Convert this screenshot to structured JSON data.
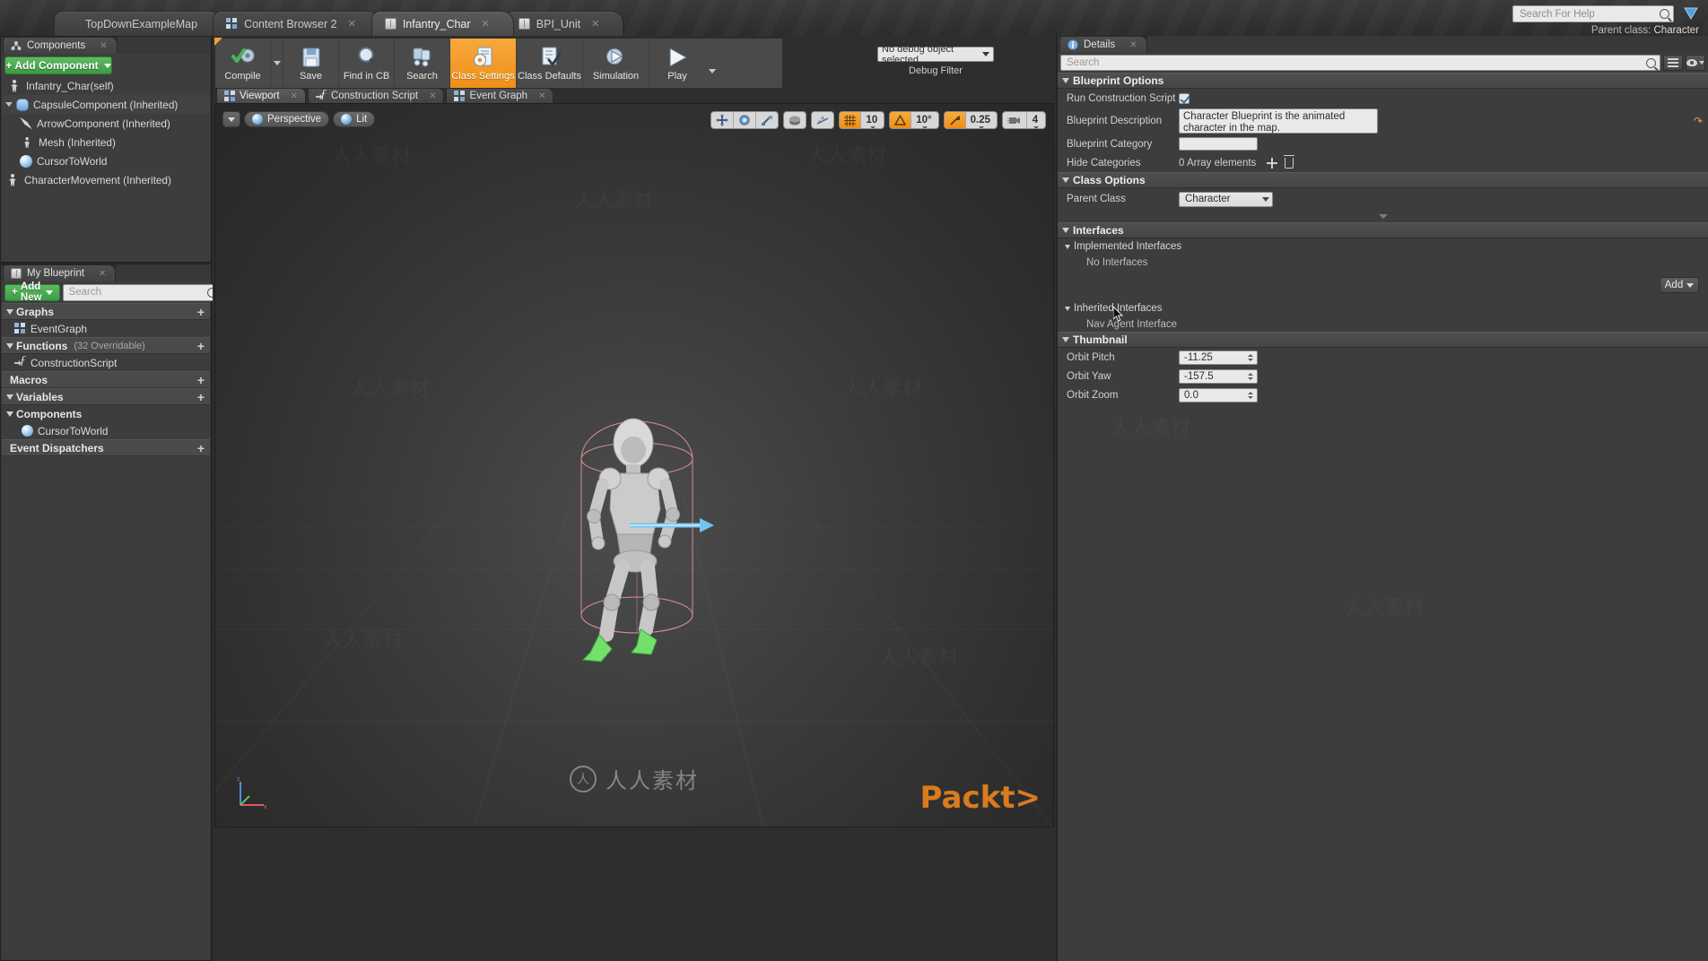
{
  "window": {
    "tabs": [
      {
        "label": "TopDownExampleMap",
        "icon": "map-icon",
        "closable": false,
        "active": false
      },
      {
        "label": "Content Browser 2",
        "icon": "grid-icon",
        "closable": true,
        "active": false
      },
      {
        "label": "Infantry_Char",
        "icon": "blueprint-icon",
        "closable": true,
        "active": true
      },
      {
        "label": "BPI_Unit",
        "icon": "blueprint-icon",
        "closable": true,
        "active": false
      }
    ],
    "help_search_placeholder": "Search For Help",
    "parent_class_label": "Parent class:",
    "parent_class_value": "Character"
  },
  "components_panel": {
    "tab_label": "Components",
    "tab_icon": "components-icon",
    "add_component_label": "Add Component",
    "tree": [
      {
        "label": "Infantry_Char(self)",
        "icon": "character-icon",
        "indent": 0,
        "expander": "none"
      },
      {
        "label": "CapsuleComponent (Inherited)",
        "icon": "capsule-icon",
        "indent": 0,
        "expander": "expanded"
      },
      {
        "label": "ArrowComponent (Inherited)",
        "icon": "arrow-icon",
        "indent": 1,
        "expander": "none"
      },
      {
        "label": "Mesh (Inherited)",
        "icon": "skeletal-mesh-icon",
        "indent": 1,
        "expander": "none"
      },
      {
        "label": "CursorToWorld",
        "icon": "decal-icon",
        "indent": 1,
        "expander": "none"
      },
      {
        "label": "CharacterMovement (Inherited)",
        "icon": "movement-icon",
        "indent": 0,
        "expander": "none"
      }
    ]
  },
  "my_blueprint_panel": {
    "tab_label": "My Blueprint",
    "tab_icon": "blueprint-icon",
    "add_new_label": "Add New",
    "search_placeholder": "Search",
    "sections": [
      {
        "title": "Graphs",
        "sub": "",
        "plus": "+",
        "items": [
          {
            "label": "EventGraph",
            "icon": "event-graph-icon"
          }
        ]
      },
      {
        "title": "Functions",
        "sub": "(32 Overridable)",
        "plus": "+",
        "items": [
          {
            "label": "ConstructionScript",
            "icon": "function-icon"
          }
        ]
      },
      {
        "title": "Macros",
        "sub": "",
        "plus": "+",
        "items": []
      },
      {
        "title": "Variables",
        "sub": "",
        "plus": "+",
        "items": []
      },
      {
        "title": "Components",
        "sub": "",
        "plus": "",
        "items": [
          {
            "label": "CursorToWorld",
            "icon": "decal-icon"
          }
        ]
      },
      {
        "title": "Event Dispatchers",
        "sub": "",
        "plus": "+",
        "items": []
      }
    ]
  },
  "blueprint_toolbar": {
    "buttons": [
      {
        "label": "Compile",
        "icon": "compile-icon",
        "active": false,
        "has_dropdown": true
      },
      {
        "label": "Save",
        "icon": "save-icon",
        "active": false,
        "has_dropdown": false
      },
      {
        "label": "Find in CB",
        "icon": "find-in-cb-icon",
        "active": false,
        "has_dropdown": false
      },
      {
        "label": "Search",
        "icon": "search-icon",
        "active": false,
        "has_dropdown": false
      },
      {
        "label": "Class Settings",
        "icon": "class-settings-icon",
        "active": true,
        "has_dropdown": false
      },
      {
        "label": "Class Defaults",
        "icon": "class-defaults-icon",
        "active": false,
        "has_dropdown": false
      },
      {
        "label": "Simulation",
        "icon": "simulation-icon",
        "active": false,
        "has_dropdown": false
      },
      {
        "label": "Play",
        "icon": "play-icon",
        "active": false,
        "has_dropdown": true
      }
    ],
    "debug_object_value": "No debug object selected",
    "debug_filter_label": "Debug Filter"
  },
  "editor_tabs": [
    {
      "label": "Viewport",
      "icon": "viewport-icon",
      "active": true,
      "closable": true
    },
    {
      "label": "Construction Script",
      "icon": "function-icon",
      "active": false,
      "closable": true
    },
    {
      "label": "Event Graph",
      "icon": "event-graph-icon",
      "active": false,
      "closable": true
    }
  ],
  "viewport": {
    "view_mode": "Perspective",
    "lighting_mode": "Lit",
    "transform_tools": [
      "translate-icon",
      "rotate-icon",
      "scale-icon"
    ],
    "coord_space": "world-space-icon",
    "surface_snap": "surface-snap-icon",
    "grid_snap_enabled": true,
    "grid_snap_value": "10",
    "rotation_snap_enabled": false,
    "rotation_snap_value": "10°",
    "scale_snap_enabled": true,
    "scale_snap_value": "0.25",
    "camera_speed_value": "4",
    "watermark_center": "人人素材",
    "watermark_mark": "人",
    "branding": "Packt"
  },
  "details_panel": {
    "tab_label": "Details",
    "tab_icon": "details-icon",
    "search_placeholder": "Search",
    "toolbar_icons": [
      "column-view-icon",
      "visibility-filter-icon"
    ],
    "categories": [
      {
        "name": "Blueprint Options",
        "rows": [
          {
            "label": "Run Construction Script on D",
            "type": "checkbox",
            "value": true
          },
          {
            "label": "Blueprint Description",
            "type": "textarea",
            "value": "Character Blueprint is the animated character in the map."
          },
          {
            "label": "Blueprint Category",
            "type": "text",
            "value": ""
          },
          {
            "label": "Hide Categories",
            "type": "array",
            "value": "0 Array elements",
            "buttons": [
              "add-element-icon",
              "clear-array-icon"
            ]
          }
        ]
      },
      {
        "name": "Class Options",
        "rows": [
          {
            "label": "Parent Class",
            "type": "combo",
            "value": "Character"
          }
        ]
      },
      {
        "name": "Interfaces",
        "subsections": [
          {
            "name": "Implemented Interfaces",
            "items": [
              "No Interfaces"
            ],
            "add_label": "Add"
          },
          {
            "name": "Inherited Interfaces",
            "items": [
              "Nav Agent Interface"
            ]
          }
        ]
      },
      {
        "name": "Thumbnail",
        "rows": [
          {
            "label": "Orbit Pitch",
            "type": "number",
            "value": "-11.25"
          },
          {
            "label": "Orbit Yaw",
            "type": "number",
            "value": "-157.5"
          },
          {
            "label": "Orbit Zoom",
            "type": "number",
            "value": "0.0"
          }
        ]
      }
    ]
  }
}
